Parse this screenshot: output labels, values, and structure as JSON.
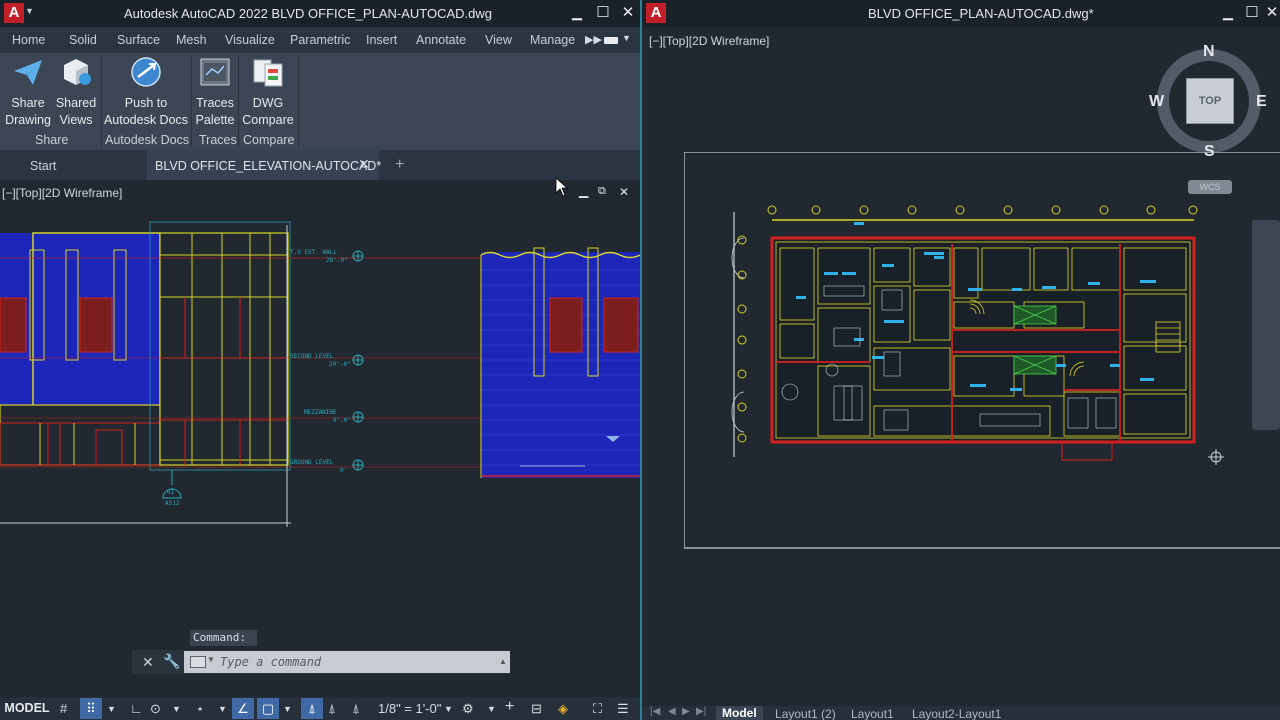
{
  "left_window": {
    "title": "Autodesk AutoCAD 2022   BLVD OFFICE_PLAN-AUTOCAD.dwg",
    "logo": "A",
    "ribbon_tabs": [
      "Home",
      "Solid",
      "Surface",
      "Mesh",
      "Visualize",
      "Parametric",
      "Insert",
      "Annotate",
      "View",
      "Manage"
    ],
    "ribbon": {
      "share_drawing": [
        "Share",
        "Drawing"
      ],
      "shared_views": [
        "Shared",
        "Views"
      ],
      "push_docs": [
        "Push to",
        "Autodesk Docs"
      ],
      "traces_palette": [
        "Traces",
        "Palette"
      ],
      "dwg_compare": [
        "DWG",
        "Compare"
      ],
      "group_share": "Share",
      "group_docs": "Autodesk Docs",
      "group_traces": "Traces",
      "group_compare": "Compare"
    },
    "doc_tabs": {
      "start": "Start",
      "active": "BLVD OFFICE_ELEVATION-AUTOCAD*"
    },
    "viewport_label": "[−][Top][2D Wireframe]",
    "drawing_text": {
      "level_top": "T.O EXT. WALL",
      "level_top_val": "28'-0\"",
      "second_level": "SECOND LEVEL",
      "second_val": "20'-0\"",
      "mezzanine": "MEZZANINE",
      "mezzanine_val": "9'-0\"",
      "ground_level": "GROUND LEVEL",
      "ground_val": "0'",
      "marker_num": "01",
      "marker_sheet": "A512"
    },
    "command": {
      "label": "Command:",
      "placeholder": "Type a command"
    },
    "statusbar": {
      "model": "MODEL",
      "scale": "1/8\" = 1'-0\""
    }
  },
  "right_window": {
    "title": "BLVD OFFICE_PLAN-AUTOCAD.dwg*",
    "logo": "A",
    "viewport_label": "[−][Top][2D Wireframe]",
    "viewcube": {
      "face": "TOP",
      "north": "N",
      "south": "S",
      "east": "E",
      "west": "W"
    },
    "wcs": "WCS",
    "layout_tabs": [
      "Model",
      "Layout1 (2)",
      "Layout1",
      "Layout2-Layout1"
    ]
  },
  "colors": {
    "accent_blue": "#3f6aa5",
    "autocad_red": "#c21f2a",
    "cad_yellow": "#e0dc2a",
    "cad_red": "#d42020",
    "cad_cyan": "#2aa8b8",
    "cad_blue_fill": "#1c26b8"
  }
}
